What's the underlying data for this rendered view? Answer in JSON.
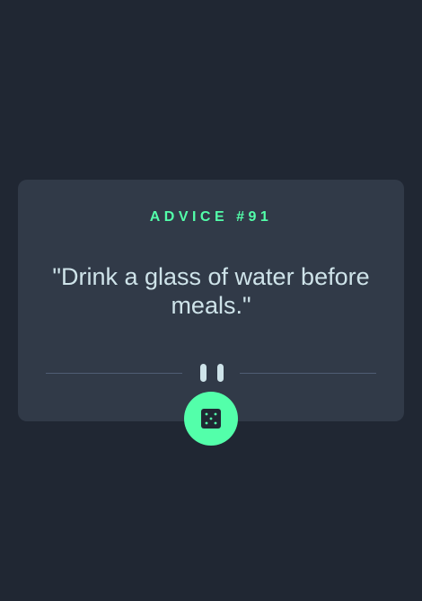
{
  "card": {
    "title": "ADVICE #91",
    "quote": "\"Drink a glass of water before meals.\""
  },
  "icons": {
    "divider": "pause-icon",
    "button": "dice-icon"
  },
  "colors": {
    "background": "#202733",
    "card": "#313a48",
    "accent": "#53ffaa",
    "text": "#cee3e9",
    "divider": "#4f5d74"
  }
}
